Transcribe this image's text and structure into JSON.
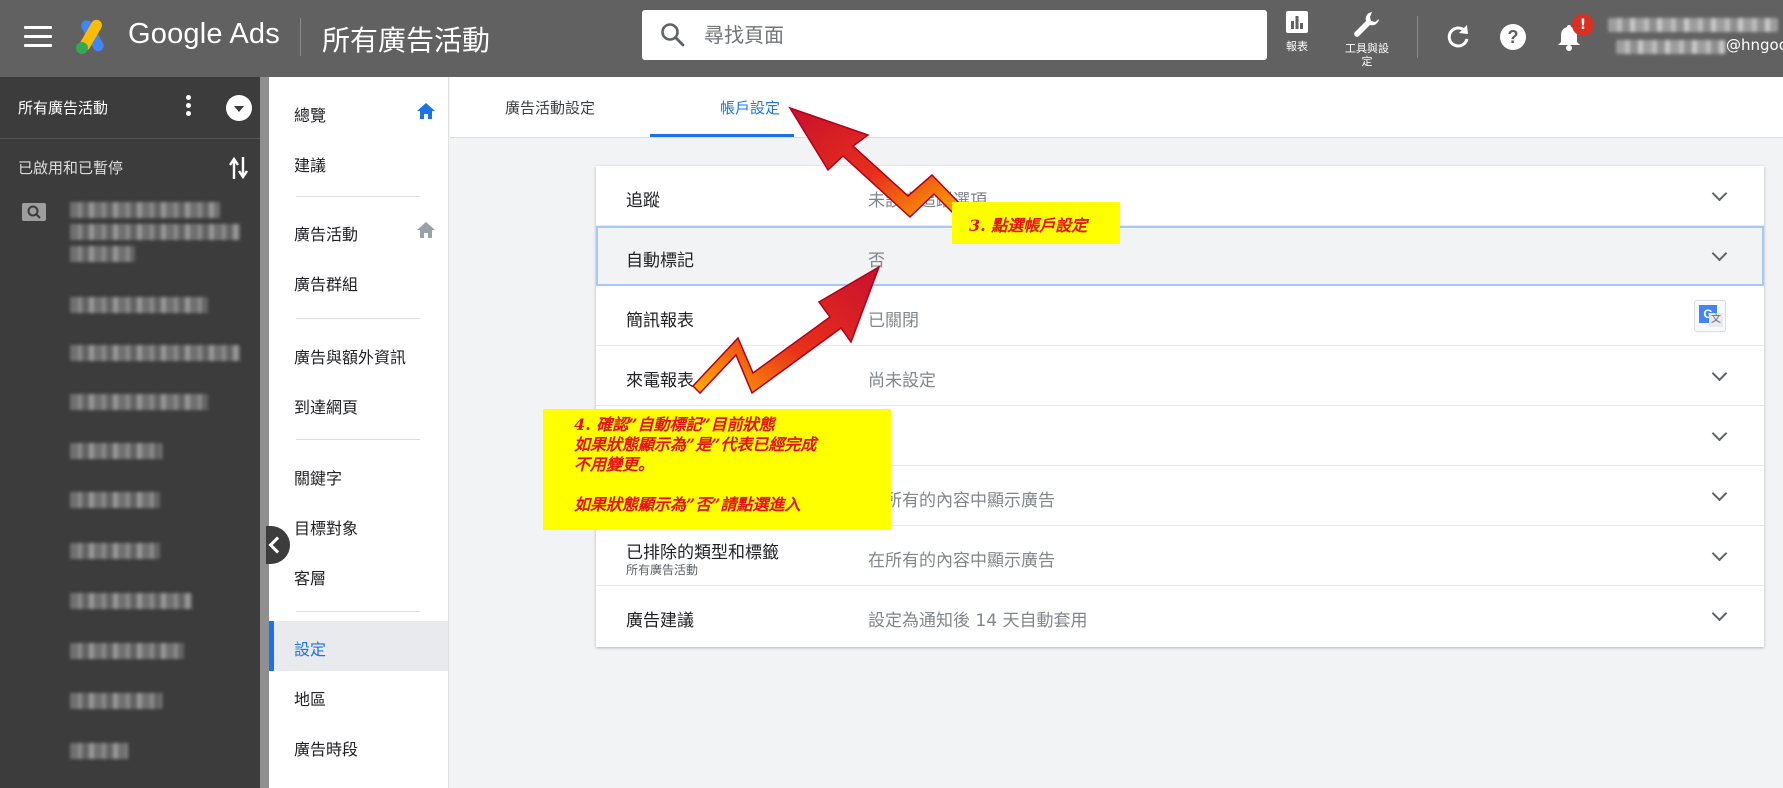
{
  "header": {
    "brand": "Google Ads",
    "page_title": "所有廣告活動",
    "search_placeholder": "尋找頁面",
    "report_label": "報表",
    "tools_label_line1": "工具與設",
    "tools_label_line2": "定",
    "notification_badge": "!",
    "account_domain": "@hngoo"
  },
  "left_nav": {
    "scope_title": "所有廣告活動",
    "filter_label": "已啟用和已暫停"
  },
  "sub_nav": {
    "items": [
      "總覽",
      "建議",
      "廣告活動",
      "廣告群組",
      "廣告與額外資訊",
      "到達網頁",
      "關鍵字",
      "目標對象",
      "客層",
      "設定",
      "地區",
      "廣告時段"
    ],
    "active": "設定"
  },
  "tabs": {
    "campaign_settings": "廣告活動設定",
    "account_settings": "帳戶設定",
    "active": "帳戶設定"
  },
  "settings_rows": [
    {
      "label": "追蹤",
      "value": "未設定追蹤選項"
    },
    {
      "label": "自動標記",
      "value": "否"
    },
    {
      "label": "簡訊報表",
      "value": "已關閉"
    },
    {
      "label": "來電報表",
      "value": "尚未設定"
    },
    {
      "label": "",
      "value": ""
    },
    {
      "label": "",
      "value": "在所有的內容中顯示廣告"
    },
    {
      "label": "已排除的類型和標籤",
      "sublabel": "所有廣告活動",
      "value": "在所有的內容中顯示廣告"
    },
    {
      "label": "廣告建議",
      "value": "設定為通知後 14 天自動套用"
    }
  ],
  "annotations": {
    "step3": "3. 點選帳戶設定",
    "step4_line1": "4. 確認”自動標記”目前狀態",
    "step4_line2": "如果狀態顯示為”是”代表已經完成",
    "step4_line3": "不用變更。",
    "step4_line4": "如果狀態顯示為”否”請點選進入"
  },
  "colors": {
    "header_bg": "#616161",
    "left_nav_bg": "#3c3c3c",
    "accent": "#1a73e8",
    "annotation_bg": "#ffff00",
    "annotation_text": "#e8101a"
  }
}
